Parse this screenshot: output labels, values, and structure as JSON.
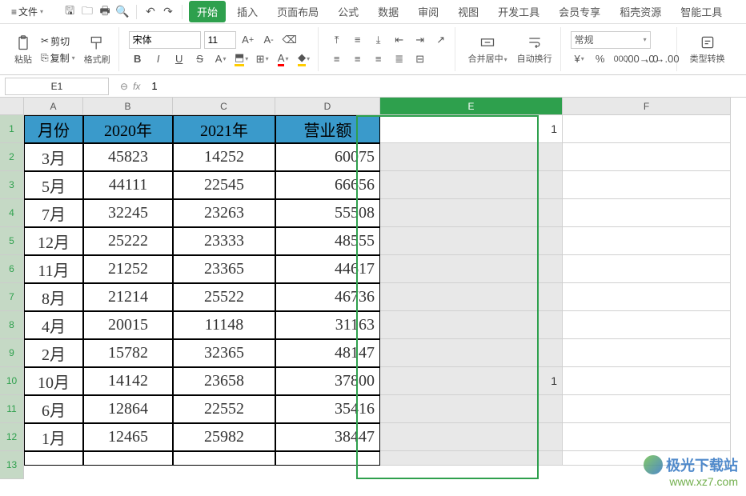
{
  "menubar": {
    "file": "文件",
    "tabs": [
      "开始",
      "插入",
      "页面布局",
      "公式",
      "数据",
      "审阅",
      "视图",
      "开发工具",
      "会员专享",
      "稻壳资源",
      "智能工具"
    ]
  },
  "ribbon": {
    "clipboard": {
      "paste": "粘贴",
      "cut": "剪切",
      "copy": "复制",
      "format_painter": "格式刷"
    },
    "font": {
      "name": "宋体",
      "size": "11",
      "bold": "B",
      "italic": "I",
      "underline": "U",
      "strike": "S",
      "aplus": "A",
      "aminus": "A"
    },
    "align": {
      "merge": "合并居中",
      "wrap": "自动换行"
    },
    "number": {
      "format": "常规",
      "type_convert": "类型转换"
    }
  },
  "formula_bar": {
    "name_box": "E1",
    "fx": "fx",
    "value": "1"
  },
  "columns": [
    "A",
    "B",
    "C",
    "D",
    "E",
    "F"
  ],
  "selected_col": "E",
  "header_row": [
    "月份",
    "2020年",
    "2021年",
    "营业额"
  ],
  "rows": [
    {
      "month": "3月",
      "y2020": "45823",
      "y2021": "14252",
      "total": "60075"
    },
    {
      "month": "5月",
      "y2020": "44111",
      "y2021": "22545",
      "total": "66656"
    },
    {
      "month": "7月",
      "y2020": "32245",
      "y2021": "23263",
      "total": "55508"
    },
    {
      "month": "12月",
      "y2020": "25222",
      "y2021": "23333",
      "total": "48555"
    },
    {
      "month": "11月",
      "y2020": "21252",
      "y2021": "23365",
      "total": "44617"
    },
    {
      "month": "8月",
      "y2020": "21214",
      "y2021": "25522",
      "total": "46736"
    },
    {
      "month": "4月",
      "y2020": "20015",
      "y2021": "11148",
      "total": "31163"
    },
    {
      "month": "2月",
      "y2020": "15782",
      "y2021": "32365",
      "total": "48147"
    },
    {
      "month": "10月",
      "y2020": "14142",
      "y2021": "23658",
      "total": "37800"
    },
    {
      "month": "6月",
      "y2020": "12864",
      "y2021": "22552",
      "total": "35416"
    },
    {
      "month": "1月",
      "y2020": "12465",
      "y2021": "25982",
      "total": "38447"
    }
  ],
  "e_values": {
    "E1": "1",
    "E10": "1"
  },
  "watermark": {
    "line1": "极光下载站",
    "line2": "www.xz7.com"
  }
}
